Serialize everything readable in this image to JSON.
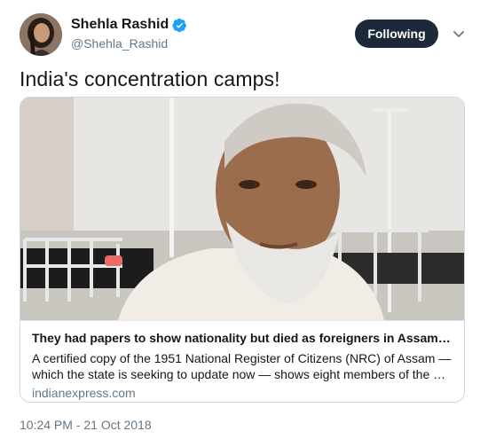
{
  "author": {
    "display_name": "Shehla Rashid",
    "handle": "@Shehla_Rashid",
    "verified": true
  },
  "follow_button": {
    "label": "Following"
  },
  "menu": {
    "icon": "chevron-down-icon"
  },
  "tweet": {
    "text": "India's concentration camps!",
    "timestamp": "10:24 PM - 21 Oct 2018"
  },
  "card": {
    "title": "They had papers to show nationality but died as foreigners in Assam ca...",
    "description_line1": "A certified copy of the 1951 National Register of Citizens (NRC) of Assam —",
    "description_line2": "which the state is seeking to update now — shows eight members of the Dey f...",
    "domain": "indianexpress.com"
  },
  "colors": {
    "follow_bg": "#1c2938",
    "verified": "#1da1f2",
    "secondary_text": "#657786",
    "border": "#ccd6dd"
  }
}
